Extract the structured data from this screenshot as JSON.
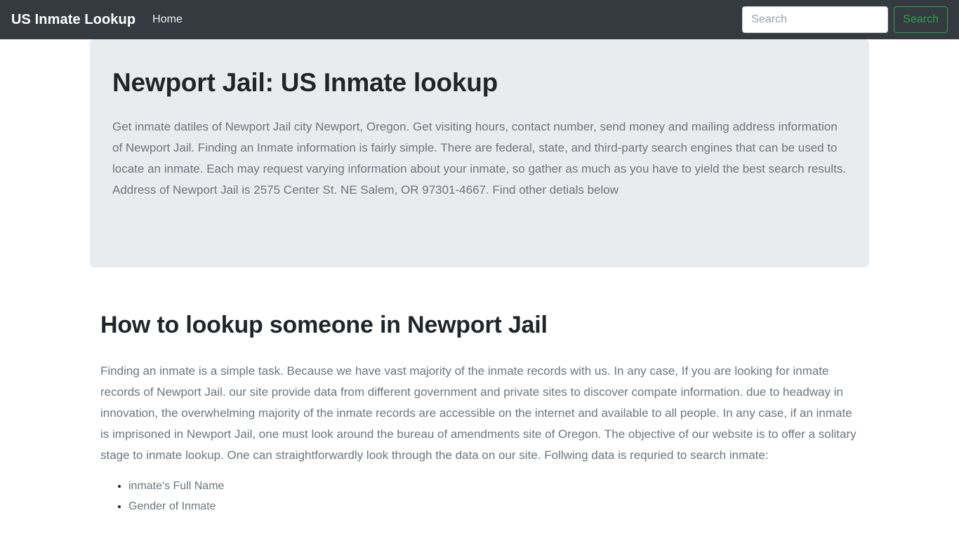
{
  "navbar": {
    "brand": "US Inmate Lookup",
    "links": [
      {
        "label": "Home",
        "name": "nav-link-home"
      }
    ],
    "search": {
      "placeholder": "Search",
      "value": "",
      "button_label": "Search",
      "button_color": "#28a745"
    },
    "background_color": "#343a40"
  },
  "hero": {
    "title": "Newport Jail: US Inmate lookup",
    "body": "Get inmate datiles of Newport Jail city Newport, Oregon. Get visiting hours, contact number, send money and mailing address information of Newport Jail. Finding an Inmate information is fairly simple. There are federal, state, and third-party search engines that can be used to locate an inmate. Each may request varying information about your inmate, so gather as much as you have to yield the best search results. Address of Newport Jail is 2575 Center St. NE Salem, OR 97301-4667. Find other detials below",
    "background_color": "#e9ecef"
  },
  "section": {
    "heading": "How to lookup someone in Newport Jail",
    "paragraph": "Finding an inmate is a simple task. Because we have vast majority of the inmate records with us. In any case, If you are looking for inmate records of Newport Jail. our site provide data from different government and private sites to discover compate information. due to headway in innovation, the overwhelming majority of the inmate records are accessible on the internet and available to all people. In any case, if an inmate is imprisoned in Newport Jail, one must look around the bureau of amendments site of Oregon. The objective of our website is to offer a solitary stage to inmate lookup. One can straightforwardly look through the data on our site. Follwing data is requried to search inmate:",
    "list": [
      "inmate's Full Name",
      "Gender of Inmate"
    ]
  }
}
